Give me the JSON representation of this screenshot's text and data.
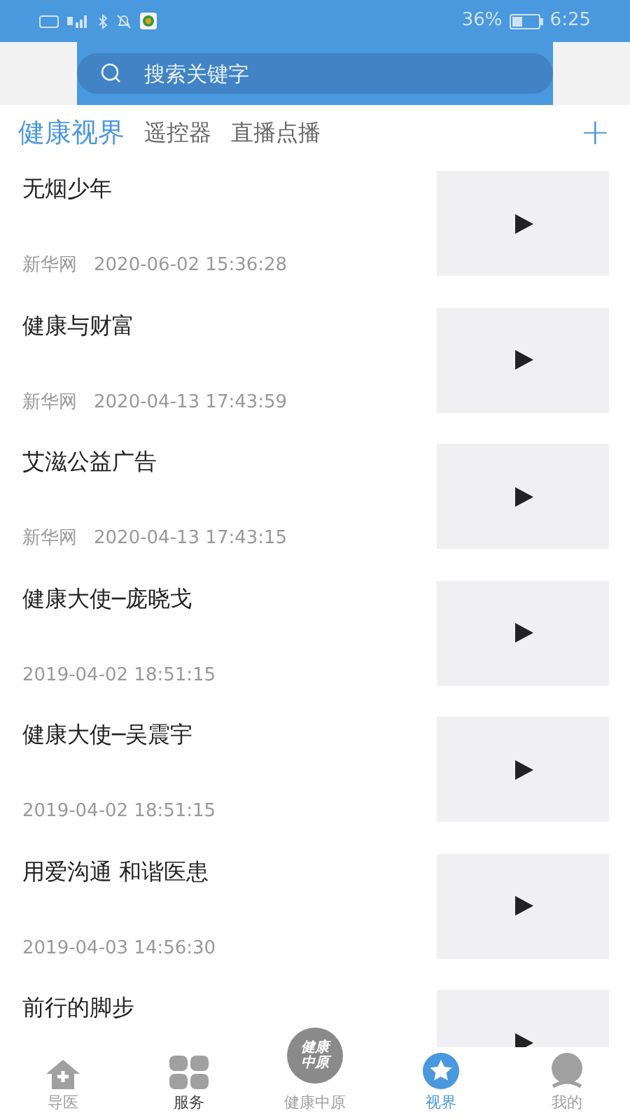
{
  "status_bar": {
    "battery": "36%",
    "time": "6:25"
  },
  "search": {
    "placeholder": "搜索关键字"
  },
  "tabs": [
    {
      "label": "健康视界",
      "selected": true
    },
    {
      "label": "遥控器",
      "selected": false
    },
    {
      "label": "直播点播",
      "selected": false
    }
  ],
  "add_button": "+",
  "videos": [
    {
      "title": "无烟少年",
      "source": "新华网",
      "time": "2020-06-02 15:36:28"
    },
    {
      "title": "健康与财富",
      "source": "新华网",
      "time": "2020-04-13 17:43:59"
    },
    {
      "title": "艾滋公益广告",
      "source": "新华网",
      "time": "2020-04-13 17:43:15"
    },
    {
      "title": "健康大使─庞晓戈",
      "time": "2019-04-02 18:51:15"
    },
    {
      "title": "健康大使─吴震宇",
      "time": "2019-04-02 18:51:15"
    },
    {
      "title": "用爱沟通 和谐医患",
      "time": "2019-04-03 14:56:30"
    },
    {
      "title": "前行的脚步"
    }
  ],
  "nav": [
    {
      "kind": "home",
      "label": "导医",
      "selected": false
    },
    {
      "kind": "grid",
      "label": "服务",
      "selected": false
    },
    {
      "kind": "logo",
      "label": "健康中原",
      "logo_text": "健康中原",
      "selected": false
    },
    {
      "kind": "star",
      "label": "视界",
      "selected": true
    },
    {
      "kind": "person",
      "label": "我的",
      "selected": false
    }
  ]
}
